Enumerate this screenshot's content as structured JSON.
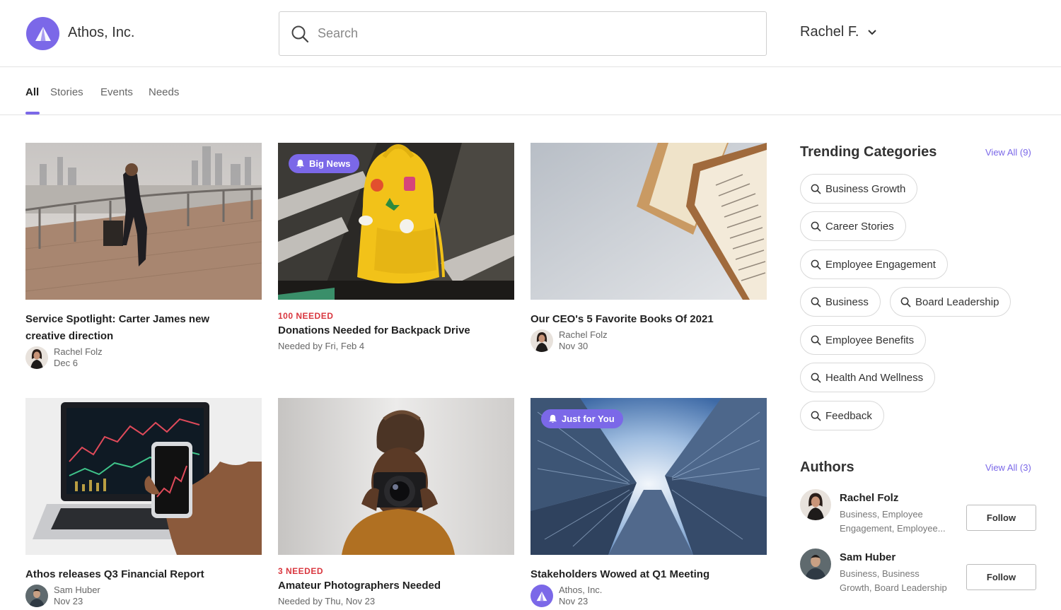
{
  "header": {
    "brand": "Athos, Inc.",
    "search_placeholder": "Search",
    "user_name": "Rachel F."
  },
  "tabs": [
    "All",
    "Stories",
    "Events",
    "Needs"
  ],
  "cards": [
    {
      "title_line1": "Service Spotlight: Carter James new",
      "title_line2": "creative direction",
      "author": "Rachel Folz",
      "date": "Dec 6"
    },
    {
      "badge": "Big News",
      "needed": "100 NEEDED",
      "title": "Donations Needed for Backpack Drive",
      "needed_by": "Needed by Fri, Feb 4"
    },
    {
      "title": "Our CEO's 5 Favorite Books Of 2021",
      "author": "Rachel Folz",
      "date": "Nov 30"
    },
    {
      "title": "Athos releases Q3 Financial Report",
      "author": "Sam Huber",
      "date": "Nov 23"
    },
    {
      "needed": "3 NEEDED",
      "title": "Amateur Photographers Needed",
      "needed_by": "Needed by Thu, Nov 23"
    },
    {
      "badge": "Just for You",
      "title": "Stakeholders Wowed at Q1 Meeting",
      "author": "Athos, Inc.",
      "date": "Nov 23"
    }
  ],
  "trending": {
    "title": "Trending Categories",
    "view_all": "View All (9)",
    "categories": [
      "Business Growth",
      "Career Stories",
      "Employee Engagement",
      "Business",
      "Board Leadership",
      "Employee Benefits",
      "Health And Wellness",
      "Feedback"
    ]
  },
  "authors": {
    "title": "Authors",
    "view_all": "View All (3)",
    "follow_label": "Follow",
    "items": [
      {
        "name": "Rachel Folz",
        "desc_line1": "Business, Employee",
        "desc_line2": "Engagement, Employee..."
      },
      {
        "name": "Sam Huber",
        "desc_line1": "Business, Business",
        "desc_line2": "Growth, Board Leadership"
      }
    ]
  },
  "colors": {
    "accent": "#7b68e8",
    "needed": "#d9363e"
  }
}
